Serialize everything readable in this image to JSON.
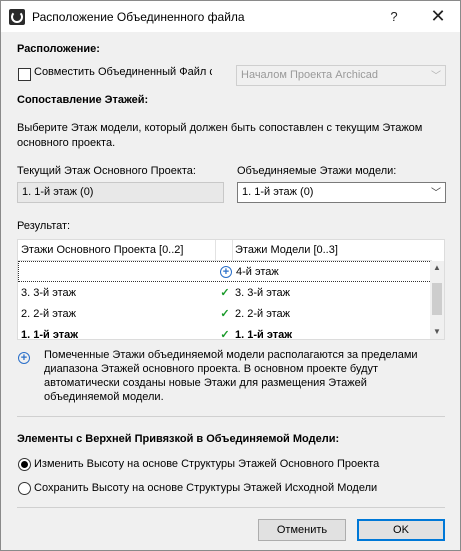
{
  "window": {
    "title": "Расположение Объединенного файла"
  },
  "titlebar": {
    "help_glyph": "?",
    "close_glyph": "✕"
  },
  "placement": {
    "heading": "Расположение:",
    "checkbox_label": "Совместить Объединенный Файл с",
    "checked": false,
    "combo_value": "Началом Проекта Archicad"
  },
  "stories": {
    "heading": "Сопоставление Этажей:",
    "instruction_line1": "Выберите Этаж модели, который должен быть сопоставлен с текущим Этажом",
    "instruction_line2": "основного проекта.",
    "current_label": "Текущий Этаж Основного Проекта:",
    "current_value": "1. 1-й этаж (0)",
    "merged_label": "Объединяемые Этажи модели:",
    "merged_value": "1. 1-й этаж (0)"
  },
  "result": {
    "label": "Результат:",
    "col_host": "Этажи Основного Проекта [0..2]",
    "col_model": "Этажи Модели [0..3]",
    "rows": [
      {
        "host": "",
        "mark": "+",
        "model": "4-й этаж"
      },
      {
        "host": "3. 3-й этаж",
        "mark": "✓",
        "model": "3. 3-й этаж"
      },
      {
        "host": "2. 2-й этаж",
        "mark": "✓",
        "model": "2. 2-й этаж"
      },
      {
        "host": "1. 1-й этаж",
        "mark": "✓",
        "model": "1. 1-й этаж"
      }
    ]
  },
  "note": {
    "line1": "Помеченные Этажи объединяемой модели располагаются за пределами",
    "line2": "диапазона Этажей основного проекта. В основном проекте будут",
    "line3": "автоматически созданы новые Этажи для размещения Этажей",
    "line4": "объединяемой модели."
  },
  "top_linked": {
    "heading": "Элементы с Верхней Привязкой в Объединяемой Модели:",
    "option1": "Изменить Высоту на основе Структуры Этажей Основного Проекта",
    "option2": "Сохранить Высоту на основе Структуры Этажей Исходной Модели",
    "selected": 1
  },
  "buttons": {
    "cancel": "Отменить",
    "ok": "OK"
  },
  "colors": {
    "accent": "#0078d7",
    "check": "#1a9a2a",
    "plus": "#2a6fc9"
  },
  "icons": {
    "plus": "plus-circle-icon",
    "check": "checkmark-icon"
  }
}
